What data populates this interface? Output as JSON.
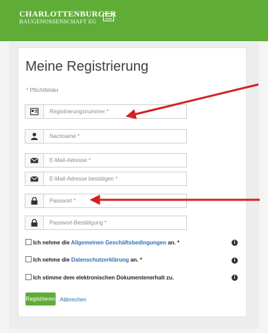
{
  "brand": {
    "line1": "CHARLOTTENBURGER",
    "line2": "BAUGENOSSENSCHAFT EG"
  },
  "form": {
    "title": "Meine Registrierung",
    "required_note": "* Pflichtfelder",
    "fields": [
      {
        "icon": "id-card-icon",
        "placeholder": "Registrierungsnummer *"
      },
      {
        "icon": "user-icon",
        "placeholder": "Nachname *"
      },
      {
        "icon": "envelope-icon",
        "placeholder": "E-Mail-Adresse *"
      },
      {
        "icon": "envelope-icon",
        "placeholder": "E-Mail-Adresse bestätigen *"
      },
      {
        "icon": "lock-icon",
        "placeholder": "Passwort *"
      },
      {
        "icon": "lock-icon",
        "placeholder": "Passwort-Bestätigung *"
      }
    ],
    "checkboxes": [
      {
        "pre": "Ich nehme die ",
        "link": "Allgemeinen Geschäftsbedingungen",
        "post": " an.  *",
        "checked": false
      },
      {
        "pre": "Ich nehme die ",
        "link": "Datenschutzerklärung",
        "post": " an.  *",
        "checked": false
      },
      {
        "pre": "Ich stimme dem elektronischen Dokumentenerhalt zu.",
        "link": "",
        "post": "",
        "checked": false
      }
    ],
    "submit_label": "Registrieren",
    "cancel_label": "Abbrechen"
  },
  "colors": {
    "brand_green": "#5fad37",
    "link_blue": "#2c6fb3",
    "annotation_red": "#d42020"
  }
}
